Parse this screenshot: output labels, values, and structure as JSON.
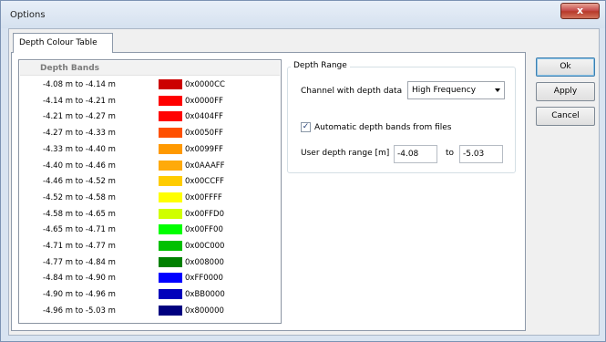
{
  "window": {
    "title": "Options",
    "close_glyph": "x"
  },
  "tabs": [
    {
      "label": "Depth Colour Table"
    }
  ],
  "depth_bands": {
    "header": "Depth Bands",
    "rows": [
      {
        "range": "-4.08 m to -4.14 m",
        "hex": "0x0000CC",
        "color": "#CC0000"
      },
      {
        "range": "-4.14 m to -4.21 m",
        "hex": "0x0000FF",
        "color": "#FF0000"
      },
      {
        "range": "-4.21 m to -4.27 m",
        "hex": "0x0404FF",
        "color": "#FF0404"
      },
      {
        "range": "-4.27 m to -4.33 m",
        "hex": "0x0050FF",
        "color": "#FF5000"
      },
      {
        "range": "-4.33 m to -4.40 m",
        "hex": "0x0099FF",
        "color": "#FF9900"
      },
      {
        "range": "-4.40 m to -4.46 m",
        "hex": "0x0AAAFF",
        "color": "#FFAA0A"
      },
      {
        "range": "-4.46 m to -4.52 m",
        "hex": "0x00CCFF",
        "color": "#FFCC00"
      },
      {
        "range": "-4.52 m to -4.58 m",
        "hex": "0x00FFFF",
        "color": "#FFFF00"
      },
      {
        "range": "-4.58 m to -4.65 m",
        "hex": "0x00FFD0",
        "color": "#D0FF00"
      },
      {
        "range": "-4.65 m to -4.71 m",
        "hex": "0x00FF00",
        "color": "#00FF00"
      },
      {
        "range": "-4.71 m to -4.77 m",
        "hex": "0x00C000",
        "color": "#00C000"
      },
      {
        "range": "-4.77 m to -4.84 m",
        "hex": "0x008000",
        "color": "#008000"
      },
      {
        "range": "-4.84 m to -4.90 m",
        "hex": "0xFF0000",
        "color": "#0000FF"
      },
      {
        "range": "-4.90 m to -4.96 m",
        "hex": "0xBB0000",
        "color": "#0000BB"
      },
      {
        "range": "-4.96 m to -5.03 m",
        "hex": "0x800000",
        "color": "#000080"
      }
    ]
  },
  "depth_range": {
    "title": "Depth Range",
    "channel_label": "Channel with depth data",
    "channel_value": "High Frequency",
    "auto_label": "Automatic depth bands from files",
    "auto_checked": true,
    "user_range_label": "User depth range [m]",
    "from_value": "-4.08",
    "to_label": "to",
    "to_value": "-5.03"
  },
  "buttons": {
    "ok": "Ok",
    "apply": "Apply",
    "cancel": "Cancel"
  }
}
